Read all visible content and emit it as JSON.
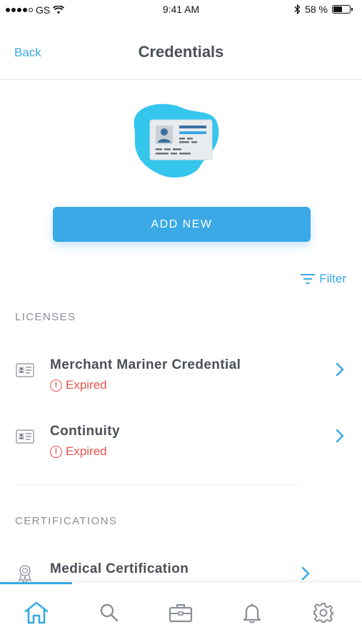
{
  "status_bar": {
    "carrier": "GS",
    "time": "9:41 AM",
    "battery_percent_label": "58 %",
    "battery_level": 0.58
  },
  "nav": {
    "back_label": "Back",
    "title": "Credentials"
  },
  "actions": {
    "add_new_label": "ADD NEW",
    "filter_label": "Filter"
  },
  "sections": {
    "licenses_header": "LICENSES",
    "certifications_header": "CERTIFICATIONS"
  },
  "licenses": [
    {
      "title": "Merchant Mariner Credential",
      "status": "Expired",
      "icon": "id-card-icon"
    },
    {
      "title": "Continuity",
      "status": "Expired",
      "icon": "id-card-icon"
    }
  ],
  "certifications": [
    {
      "title": "Medical Certification",
      "icon": "ribbon-icon"
    }
  ],
  "tab_bar": {
    "tabs": [
      "home-icon",
      "search-icon",
      "briefcase-icon",
      "bell-icon",
      "gear-icon"
    ],
    "active": "home-icon"
  },
  "colors": {
    "accent": "#3aa9e6",
    "error": "#e5534b",
    "title": "#4a4f58",
    "muted": "#8a8f97",
    "hero_blob": "#35c6ee"
  }
}
